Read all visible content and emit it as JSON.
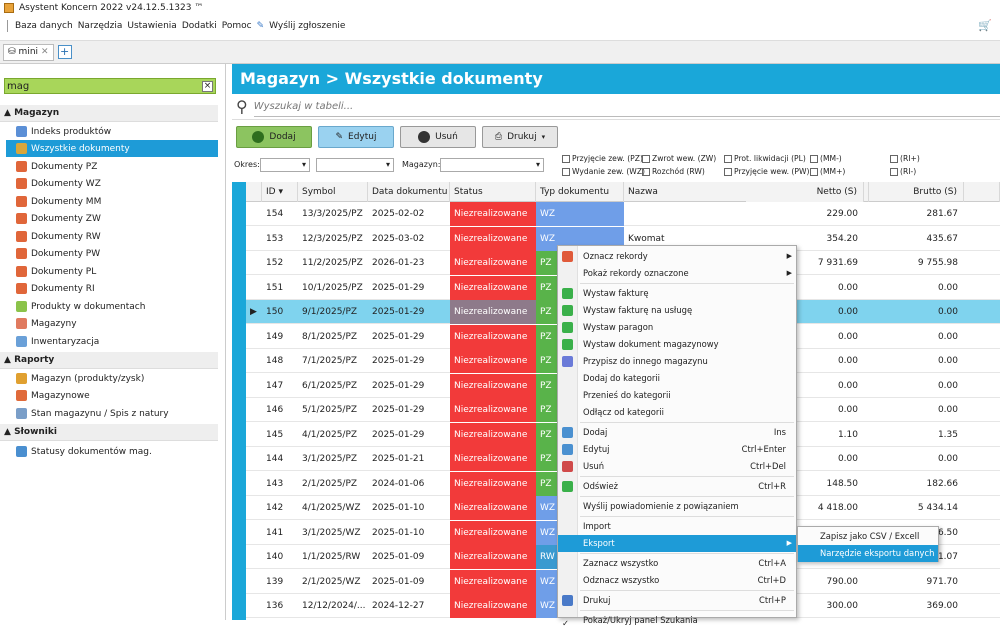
{
  "window": {
    "title": "Asystent Koncern 2022 v24.12.5.1323 ™"
  },
  "menu": [
    "Baza danych",
    "Narzędzia",
    "Ustawienia",
    "Dodatki",
    "Pomoc",
    "Wyślij zgłoszenie"
  ],
  "tab": {
    "label": "mini"
  },
  "sidebar": {
    "search_value": "mag",
    "sections": [
      {
        "title": "Magazyn",
        "items": [
          "Indeks produktów",
          "Wszystkie dokumenty",
          "Dokumenty PZ",
          "Dokumenty WZ",
          "Dokumenty MM",
          "Dokumenty ZW",
          "Dokumenty RW",
          "Dokumenty PW",
          "Dokumenty PL",
          "Dokumenty RI",
          "Produkty w dokumentach",
          "Magazyny",
          "Inwentaryzacja"
        ]
      },
      {
        "title": "Raporty",
        "items": [
          "Magazyn (produkty/zysk)",
          "Magazynowe",
          "Stan magazynu / Spis z natury"
        ]
      },
      {
        "title": "Słowniki",
        "items": [
          "Statusy dokumentów mag."
        ]
      }
    ]
  },
  "main": {
    "title": "Magazyn > Wszystkie dokumenty",
    "search_placeholder": "Wyszukaj w tabeli...",
    "toolbar": {
      "add": "Dodaj",
      "edit": "Edytuj",
      "delete": "Usuń",
      "print": "Drukuj"
    },
    "filters": {
      "okres_label": "Okres:",
      "magazyn_label": "Magazyn:",
      "checks": [
        "Przyjęcie zew. (PZ)",
        "Wydanie zew. (WZ)",
        "Zwrot wew. (ZW)",
        "Rozchód (RW)",
        "Prot. likwidacji (PL)",
        "Przyjęcie wew. (PW)",
        "(MM-)",
        "(MM+)",
        "(RI+)",
        "(RI-)"
      ]
    },
    "columns": [
      "ID",
      "Symbol",
      "Data dokumentu",
      "Status",
      "Typ dokumentu",
      "Nazwa",
      "Netto (S)",
      "Brutto (S)"
    ],
    "rows": [
      {
        "id": "154",
        "symbol": "13/3/2025/PZ",
        "date": "2025-02-02",
        "status": "Niezrealizowane",
        "type": "WZ",
        "name": "",
        "netto": "229.00",
        "brutto": "281.67"
      },
      {
        "id": "153",
        "symbol": "12/3/2025/PZ",
        "date": "2025-03-02",
        "status": "Niezrealizowane",
        "type": "WZ",
        "name": "Kwomat",
        "netto": "354.20",
        "brutto": "435.67"
      },
      {
        "id": "152",
        "symbol": "11/2/2025/PZ",
        "date": "2026-01-23",
        "status": "Niezrealizowane",
        "type": "PZ",
        "name": "",
        "netto": "7 931.69",
        "brutto": "9 755.98"
      },
      {
        "id": "151",
        "symbol": "10/1/2025/PZ",
        "date": "2025-01-29",
        "status": "Niezrealizowane",
        "type": "PZ",
        "name": "",
        "netto": "0.00",
        "brutto": "0.00"
      },
      {
        "id": "150",
        "symbol": "9/1/2025/PZ",
        "date": "2025-01-29",
        "status": "Niezrealizowane",
        "type": "PZ",
        "name": "",
        "netto": "0.00",
        "brutto": "0.00"
      },
      {
        "id": "149",
        "symbol": "8/1/2025/PZ",
        "date": "2025-01-29",
        "status": "Niezrealizowane",
        "type": "PZ",
        "name": "",
        "netto": "0.00",
        "brutto": "0.00"
      },
      {
        "id": "148",
        "symbol": "7/1/2025/PZ",
        "date": "2025-01-29",
        "status": "Niezrealizowane",
        "type": "PZ",
        "name": "",
        "netto": "0.00",
        "brutto": "0.00"
      },
      {
        "id": "147",
        "symbol": "6/1/2025/PZ",
        "date": "2025-01-29",
        "status": "Niezrealizowane",
        "type": "PZ",
        "name": "",
        "netto": "0.00",
        "brutto": "0.00"
      },
      {
        "id": "146",
        "symbol": "5/1/2025/PZ",
        "date": "2025-01-29",
        "status": "Niezrealizowane",
        "type": "PZ",
        "name": "",
        "netto": "0.00",
        "brutto": "0.00"
      },
      {
        "id": "145",
        "symbol": "4/1/2025/PZ",
        "date": "2025-01-29",
        "status": "Niezrealizowane",
        "type": "PZ",
        "name": "",
        "netto": "1.10",
        "brutto": "1.35"
      },
      {
        "id": "144",
        "symbol": "3/1/2025/PZ",
        "date": "2025-01-21",
        "status": "Niezrealizowane",
        "type": "PZ",
        "name": "",
        "netto": "0.00",
        "brutto": "0.00"
      },
      {
        "id": "143",
        "symbol": "2/1/2025/PZ",
        "date": "2024-01-06",
        "status": "Niezrealizowane",
        "type": "PZ",
        "name": "",
        "netto": "148.50",
        "brutto": "182.66"
      },
      {
        "id": "142",
        "symbol": "4/1/2025/WZ",
        "date": "2025-01-10",
        "status": "Niezrealizowane",
        "type": "WZ",
        "name": "",
        "netto": "4 418.00",
        "brutto": "5 434.14"
      },
      {
        "id": "141",
        "symbol": "3/1/2025/WZ",
        "date": "2025-01-10",
        "status": "Niezrealizowane",
        "type": "WZ",
        "name": "",
        "netto": "",
        "brutto": "6.50"
      },
      {
        "id": "140",
        "symbol": "1/1/2025/RW",
        "date": "2025-01-09",
        "status": "Niezrealizowane",
        "type": "RW",
        "name": "",
        "netto": "",
        "brutto": "1.07"
      },
      {
        "id": "139",
        "symbol": "2/1/2025/WZ",
        "date": "2025-01-09",
        "status": "Niezrealizowane",
        "type": "WZ",
        "name": "",
        "netto": "790.00",
        "brutto": "971.70"
      },
      {
        "id": "136",
        "symbol": "12/12/2024/...",
        "date": "2024-12-27",
        "status": "Niezrealizowane",
        "type": "WZ",
        "name": "",
        "netto": "300.00",
        "brutto": "369.00"
      }
    ]
  },
  "context_menu": [
    {
      "label": "Oznacz rekordy",
      "sub": true
    },
    {
      "label": "Pokaż rekordy oznaczone",
      "sub": true
    },
    {
      "label": "Wystaw fakturę"
    },
    {
      "label": "Wystaw fakturę na usługę"
    },
    {
      "label": "Wystaw paragon"
    },
    {
      "label": "Wystaw dokument magazynowy"
    },
    {
      "label": "Przypisz do innego magazynu"
    },
    {
      "label": "Dodaj do kategorii"
    },
    {
      "label": "Przenieś do kategorii"
    },
    {
      "label": "Odłącz od kategorii"
    },
    {
      "label": "Dodaj",
      "shortcut": "Ins"
    },
    {
      "label": "Edytuj",
      "shortcut": "Ctrl+Enter"
    },
    {
      "label": "Usuń",
      "shortcut": "Ctrl+Del"
    },
    {
      "label": "Odśwież",
      "shortcut": "Ctrl+R"
    },
    {
      "label": "Wyślij powiadomienie z powiązaniem"
    },
    {
      "label": "Import"
    },
    {
      "label": "Eksport",
      "sub": true
    },
    {
      "label": "Zaznacz wszystko",
      "shortcut": "Ctrl+A"
    },
    {
      "label": "Odznacz wszystko",
      "shortcut": "Ctrl+D"
    },
    {
      "label": "Drukuj",
      "shortcut": "Ctrl+P"
    },
    {
      "label": "Pokaż/Ukryj panel Szukania"
    }
  ],
  "submenu": [
    "Zapisz jako CSV / Excell",
    "Narzędzie eksportu danych"
  ]
}
